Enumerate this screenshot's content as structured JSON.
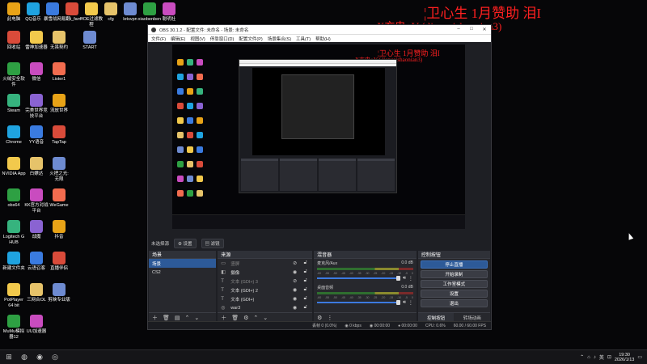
{
  "desktop": {
    "top_row": [
      {
        "label": "此电脑"
      },
      {
        "label": "QQ音乐"
      },
      {
        "label": "暴雪战网"
      },
      {
        "label": "易翻i_farm"
      },
      {
        "label": "POE过滤教程"
      },
      {
        "label": "cfg"
      },
      {
        "label": "letsvpn"
      },
      {
        "label": "xiaobenben"
      },
      {
        "label": "聪明社"
      }
    ],
    "grid": [
      {
        "label": "回收站"
      },
      {
        "label": "雷神加速器"
      },
      {
        "label": "无畏契约"
      },
      {
        "label": "START"
      },
      {
        "label": "火绒安全软件"
      },
      {
        "label": "微信"
      },
      {
        "label": "Lister1"
      },
      {
        "label": "Steam"
      },
      {
        "label": "完美世界竞技平台"
      },
      {
        "label": "流放世界"
      },
      {
        "label": "Chrome"
      },
      {
        "label": "YY语音"
      },
      {
        "label": "TapTap"
      },
      {
        "label": "NVIDIA App"
      },
      {
        "label": "白嫖达"
      },
      {
        "label": "火把之光: 无限"
      },
      {
        "label": "obs64"
      },
      {
        "label": "KK官方对战平台"
      },
      {
        "label": "WeGame"
      },
      {
        "label": "Logitech G HUB"
      },
      {
        "label": "战魔"
      },
      {
        "label": "抖音"
      },
      {
        "label": "新建文件夹"
      },
      {
        "label": "云语召客"
      },
      {
        "label": "直播伴侣"
      },
      {
        "label": "PotPlayer 64 bit"
      },
      {
        "label": "三网合OL"
      },
      {
        "label": "剪映专业版"
      },
      {
        "label": "MuMu模拟器12"
      },
      {
        "label": "UU加速器"
      }
    ]
  },
  "overlay": {
    "line1": "¦卫心生    1月赞助   泪I",
    "line2": "X充电+V ( liancaishaonian3)",
    "nested_line1": "¦卫心生    1月赞助   泪I",
    "nested_line2": "X充电+V ( liancaishaonian3)"
  },
  "obs": {
    "title": "OBS 30.1.2 - 配置文件: 未命名 - 场景: 未命名",
    "menu": [
      "文件(F)",
      "编辑(E)",
      "视图(V)",
      "停靠窗口(D)",
      "配置文件(P)",
      "场景集合(S)",
      "工具(T)",
      "帮助(H)"
    ],
    "source_bar": {
      "label": "未选择源",
      "settings": "设置",
      "filters": "滤镜"
    },
    "scenes": {
      "title": "场景",
      "items": [
        {
          "name": "场景",
          "active": true
        },
        {
          "name": "CS2",
          "active": false
        }
      ]
    },
    "sources": {
      "title": "来源",
      "items": [
        {
          "icon": "folder-icon",
          "name": "竖屏",
          "dim": true
        },
        {
          "icon": "camera-icon",
          "name": "摄像",
          "dim": false
        },
        {
          "icon": "text-icon",
          "name": "文本 (GDI+) 3",
          "dim": true
        },
        {
          "icon": "text-icon",
          "name": "文本 (GDI+) 2",
          "dim": false
        },
        {
          "icon": "text-icon",
          "name": "文本 (GDI+)",
          "dim": false
        },
        {
          "icon": "game-icon",
          "name": "war3",
          "dim": false
        }
      ]
    },
    "mixer": {
      "title": "混音器",
      "channels": [
        {
          "name": "麦克风/Aux",
          "db": "0.0 dB",
          "level": 1.0
        },
        {
          "name": "桌面音频",
          "db": "0.0 dB",
          "level": 1.0
        }
      ],
      "scale": [
        "-60",
        "-55",
        "-50",
        "-45",
        "-40",
        "-35",
        "-30",
        "-25",
        "-20",
        "-15",
        "-10",
        "-5",
        "0"
      ]
    },
    "controls": {
      "title": "控制按钮",
      "buttons": [
        "停止直播",
        "开始录制",
        "工作室模式",
        "设置",
        "退出"
      ],
      "tabs": [
        "控制按钮",
        "转场动画"
      ]
    },
    "status": {
      "dropped": "丢帧 0 (0.0%)",
      "kbps": "0 kbps",
      "live_time": "00:00:00",
      "rec_time": "00:00:00",
      "cpu": "CPU: 0.6%",
      "fps": "60.00 / 60.00 FPS"
    }
  },
  "taskbar": {
    "tray_lang": "英",
    "time": "19:30",
    "date": "2026/1/13"
  }
}
